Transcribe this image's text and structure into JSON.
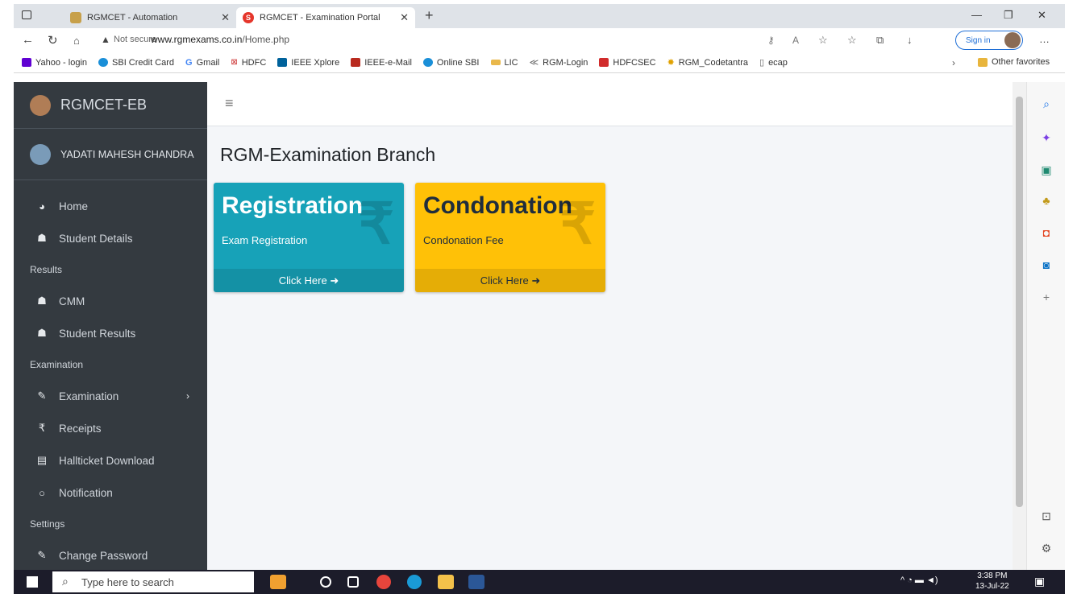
{
  "browser": {
    "tabs": [
      {
        "title": "RGMCET - Automation"
      },
      {
        "title": "RGMCET - Examination Portal"
      }
    ],
    "not_secure": "Not secure",
    "url_host": "www.rgmexams.co.in",
    "url_path": "/Home.php",
    "signin": "Sign in"
  },
  "favorites": [
    "Yahoo - login",
    "SBI Credit Card",
    "Gmail",
    "HDFC",
    "IEEE Xplore",
    "IEEE-e-Mail",
    "Online SBI",
    "LIC",
    "RGM-Login",
    "HDFCSEC",
    "RGM_Codetantra",
    "ecap"
  ],
  "other_favorites": "Other favorites",
  "sidebar": {
    "brand": "RGMCET-EB",
    "user": "YADATI MAHESH CHANDRA",
    "items": [
      {
        "label": "Home",
        "icon": "dashboard-icon"
      },
      {
        "label": "Student Details",
        "icon": "user-icon"
      }
    ],
    "results_header": "Results",
    "results_items": [
      {
        "label": "CMM",
        "icon": "user-icon"
      },
      {
        "label": "Student Results",
        "icon": "user-icon"
      }
    ],
    "exam_header": "Examination",
    "exam_items": [
      {
        "label": "Examination",
        "icon": "edit-icon"
      },
      {
        "label": "Receipts",
        "icon": "rupee-icon"
      },
      {
        "label": "Hallticket Download",
        "icon": "pdf-icon"
      },
      {
        "label": "Notification",
        "icon": "circle-icon"
      }
    ],
    "settings_header": "Settings",
    "settings_items": [
      {
        "label": "Change Password",
        "icon": "edit-icon"
      }
    ]
  },
  "main": {
    "title": "RGM-Examination Branch",
    "cards": [
      {
        "title": "Registration",
        "subtitle": "Exam Registration",
        "footer": "Click Here",
        "color": "#17a2b8"
      },
      {
        "title": "Condonation",
        "subtitle": "Condonation Fee",
        "footer": "Click Here",
        "color": "#ffc107"
      }
    ]
  },
  "taskbar": {
    "search_placeholder": "Type here to search",
    "time": "3:38 PM",
    "date": "13-Jul-22"
  }
}
